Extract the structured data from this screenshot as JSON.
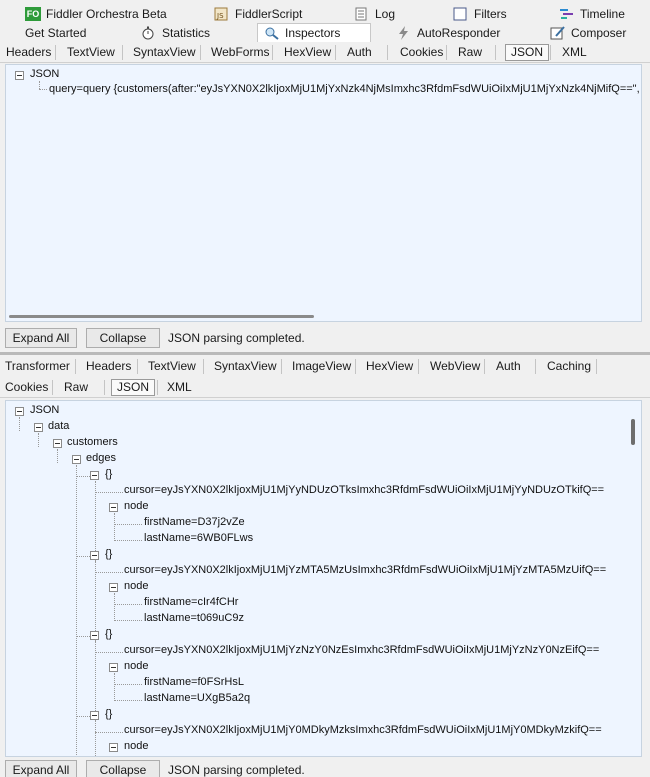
{
  "top_tabs": [
    {
      "label": "Fiddler Orchestra Beta",
      "icon": "fiddler-orchestra-icon"
    },
    {
      "label": "FiddlerScript",
      "icon": "fiddlerscript-icon"
    },
    {
      "label": "Log",
      "icon": "log-icon"
    },
    {
      "label": "Filters",
      "icon": "filters-checkbox"
    },
    {
      "label": "Timeline",
      "icon": "timeline-icon"
    },
    {
      "label": "Get Started",
      "icon": ""
    },
    {
      "label": "Statistics",
      "icon": "stopwatch-icon"
    },
    {
      "label": "Inspectors",
      "icon": "inspectors-icon",
      "selected": true
    },
    {
      "label": "AutoResponder",
      "icon": "lightning-icon"
    },
    {
      "label": "Composer",
      "icon": "composer-icon"
    }
  ],
  "fo_badge": "FO",
  "request_tabs": [
    "Headers",
    "TextView",
    "SyntaxView",
    "WebForms",
    "HexView",
    "Auth",
    "Cookies",
    "Raw",
    "JSON",
    "XML"
  ],
  "request_selected": "JSON",
  "request_tree": {
    "root": "JSON",
    "query": "query=query {customers(after:\"eyJsYXN0X2lkIjoxMjU1MjYxNzk4NjMsImxhc3RfdmFsdWUiOiIxMjU1MjYxNzk4NjMifQ==\", first:"
  },
  "response_tabs_row1": [
    "Transformer",
    "Headers",
    "TextView",
    "SyntaxView",
    "ImageView",
    "HexView",
    "WebView",
    "Auth",
    "Caching"
  ],
  "response_tabs_row2": [
    "Cookies",
    "Raw",
    "JSON",
    "XML"
  ],
  "response_selected": "JSON",
  "buttons": {
    "expand_all": "Expand All",
    "collapse": "Collapse"
  },
  "status_text": "JSON parsing completed.",
  "response_tree": {
    "root": "JSON",
    "data": "data",
    "customers": "customers",
    "edges": "edges",
    "items": [
      {
        "obj": "{}",
        "cursor": "cursor=eyJsYXN0X2lkIjoxMjU1MjYyNDUzOTksImxhc3RfdmFsdWUiOiIxMjU1MjYyNDUzOTkifQ==",
        "node": "node",
        "first": "firstName=D37j2vZe",
        "last": "lastName=6WB0FLws"
      },
      {
        "obj": "{}",
        "cursor": "cursor=eyJsYXN0X2lkIjoxMjU1MjYzMTA5MzUsImxhc3RfdmFsdWUiOiIxMjU1MjYzMTA5MzUifQ==",
        "node": "node",
        "first": "firstName=cIr4fCHr",
        "last": "lastName=t069uC9z"
      },
      {
        "obj": "{}",
        "cursor": "cursor=eyJsYXN0X2lkIjoxMjU1MjYzNzY0NzEsImxhc3RfdmFsdWUiOiIxMjU1MjYzNzY0NzEifQ==",
        "node": "node",
        "first": "firstName=f0FSrHsL",
        "last": "lastName=UXgB5a2q"
      },
      {
        "obj": "{}",
        "cursor": "cursor=eyJsYXN0X2lkIjoxMjU1MjY0MDkyMzksImxhc3RfdmFsdWUiOiIxMjU1MjY0MDkyMzkifQ==",
        "node": "node"
      }
    ]
  }
}
